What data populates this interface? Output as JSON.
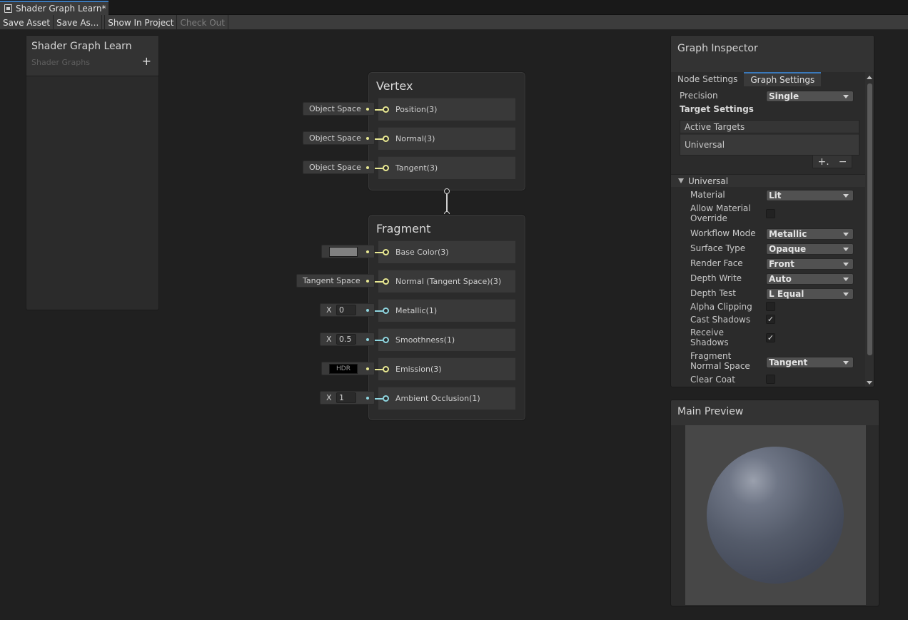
{
  "window": {
    "tab_title": "Shader Graph Learn*"
  },
  "toolbar": {
    "save_asset": "Save Asset",
    "save_as": "Save As...",
    "show_in_project": "Show In Project",
    "check_out": "Check Out"
  },
  "blackboard": {
    "title": "Shader Graph Learn",
    "subtitle": "Shader Graphs",
    "add": "+"
  },
  "vertex": {
    "title": "Vertex",
    "ports": [
      {
        "label": "Position(3)",
        "input": "Object Space"
      },
      {
        "label": "Normal(3)",
        "input": "Object Space"
      },
      {
        "label": "Tangent(3)",
        "input": "Object Space"
      }
    ]
  },
  "fragment": {
    "title": "Fragment",
    "ports": [
      {
        "label": "Base Color(3)",
        "input": "color",
        "color": "#808080"
      },
      {
        "label": "Normal (Tangent Space)(3)",
        "input": "Tangent Space"
      },
      {
        "label": "Metallic(1)",
        "axis": "X",
        "value": "0"
      },
      {
        "label": "Smoothness(1)",
        "axis": "X",
        "value": "0.5"
      },
      {
        "label": "Emission(3)",
        "input": "HDR"
      },
      {
        "label": "Ambient Occlusion(1)",
        "axis": "X",
        "value": "1"
      }
    ]
  },
  "inspector": {
    "title": "Graph Inspector",
    "tabs": [
      "Node Settings",
      "Graph Settings"
    ],
    "active_tab": "Graph Settings",
    "precision_label": "Precision",
    "precision_value": "Single",
    "target_settings": "Target Settings",
    "active_targets": "Active Targets",
    "target_item": "Universal",
    "add": "+.",
    "remove": "−",
    "section": "Universal",
    "props": {
      "material": {
        "label": "Material",
        "value": "Lit"
      },
      "allow_override": {
        "label": "Allow Material Override",
        "checked": false
      },
      "workflow": {
        "label": "Workflow Mode",
        "value": "Metallic"
      },
      "surface": {
        "label": "Surface Type",
        "value": "Opaque"
      },
      "render_face": {
        "label": "Render Face",
        "value": "Front"
      },
      "depth_write": {
        "label": "Depth Write",
        "value": "Auto"
      },
      "depth_test": {
        "label": "Depth Test",
        "value": "L Equal"
      },
      "alpha_clip": {
        "label": "Alpha Clipping",
        "checked": false
      },
      "cast_shadows": {
        "label": "Cast Shadows",
        "checked": true,
        "mark": "✓"
      },
      "receive_shadows": {
        "label": "Receive Shadows",
        "checked": true,
        "mark": "✓"
      },
      "frag_normal": {
        "label": "Fragment Normal Space",
        "value": "Tangent"
      },
      "clear_coat": {
        "label": "Clear Coat",
        "checked": false
      }
    }
  },
  "preview": {
    "title": "Main Preview"
  },
  "colors": {
    "accent": "#3a79bb",
    "vector_port": "#e8e892",
    "float_port": "#8fd6e0"
  }
}
